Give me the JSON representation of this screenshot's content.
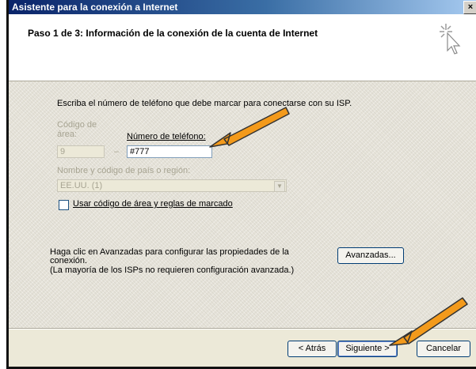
{
  "window": {
    "title": "Asistente para la conexión a Internet",
    "close_symbol": "×"
  },
  "header": {
    "title": "Paso 1 de 3: Información de la conexión de la cuenta de Internet",
    "icon": "wizard-cursor-icon"
  },
  "form": {
    "instruction": "Escriba el número de teléfono que debe marcar para conectarse con su ISP.",
    "area_code_label_line1": "Código de",
    "area_code_label_line2": "área:",
    "area_code_value": "9",
    "dash": "–",
    "phone_label": "Número de teléfono:",
    "phone_value": "#777",
    "country_label": "Nombre y código de país o región:",
    "country_value": "EE.UU. (1)",
    "use_area_rules_label": "Usar código de área y reglas de marcado",
    "advanced_text_1": "Haga clic en Avanzadas para configurar las propiedades de la",
    "advanced_text_2": "conexión.",
    "advanced_text_3": "(La mayoría de los ISPs no requieren configuración avanzada.)",
    "advanced_button": "Avanzadas..."
  },
  "footer": {
    "back_button": "< Atrás",
    "next_button": "Siguiente >",
    "cancel_button": "Cancelar"
  },
  "colors": {
    "dialog_bg": "#ece9d8",
    "titlebar": "#0a246a",
    "annotation_arrow": "#f39a1b"
  }
}
